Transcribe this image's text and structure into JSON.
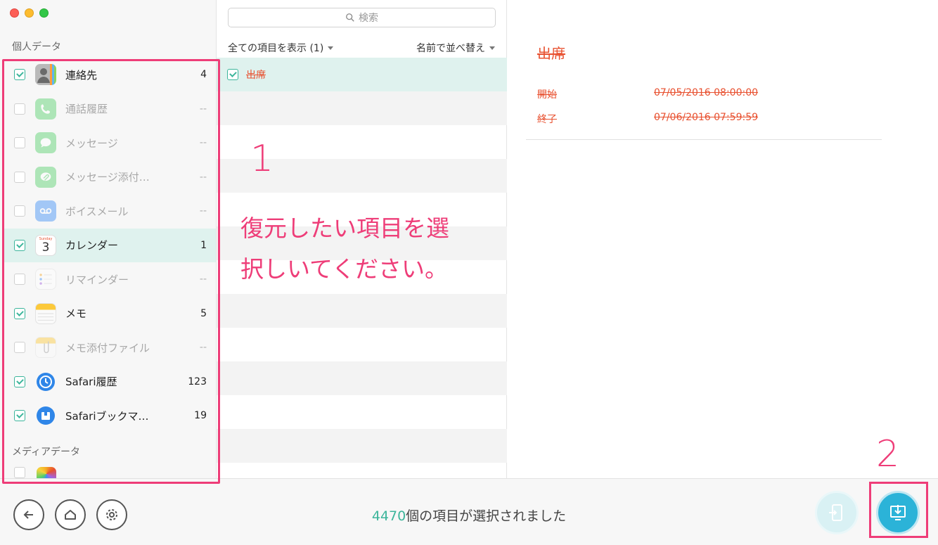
{
  "window": {
    "controls": [
      "close",
      "minimize",
      "zoom"
    ]
  },
  "sidebar": {
    "section_personal": "個人データ",
    "section_media": "メディアデータ",
    "items": [
      {
        "label": "連絡先",
        "count": "4",
        "checked": true,
        "enabled": true,
        "icon": "contacts-icon"
      },
      {
        "label": "通話履歴",
        "count": "--",
        "checked": false,
        "enabled": false,
        "icon": "phone-icon"
      },
      {
        "label": "メッセージ",
        "count": "--",
        "checked": false,
        "enabled": false,
        "icon": "messages-icon"
      },
      {
        "label": "メッセージ添付…",
        "count": "--",
        "checked": false,
        "enabled": false,
        "icon": "message-attachment-icon"
      },
      {
        "label": "ボイスメール",
        "count": "--",
        "checked": false,
        "enabled": false,
        "icon": "voicemail-icon"
      },
      {
        "label": "カレンダー",
        "count": "1",
        "checked": true,
        "enabled": true,
        "selected": true,
        "icon": "calendar-icon"
      },
      {
        "label": "リマインダー",
        "count": "--",
        "checked": false,
        "enabled": false,
        "icon": "reminders-icon"
      },
      {
        "label": "メモ",
        "count": "5",
        "checked": true,
        "enabled": true,
        "icon": "notes-icon"
      },
      {
        "label": "メモ添付ファイル",
        "count": "--",
        "checked": false,
        "enabled": false,
        "icon": "notes-attachment-icon"
      },
      {
        "label": "Safari履歴",
        "count": "123",
        "checked": true,
        "enabled": true,
        "icon": "safari-history-icon"
      },
      {
        "label": "Safariブックマ…",
        "count": "19",
        "checked": true,
        "enabled": true,
        "icon": "safari-bookmark-icon"
      }
    ],
    "calendar_icon_day": "3",
    "calendar_icon_weekday": "Sunday"
  },
  "middle": {
    "search_placeholder": "検索",
    "show_all": "全ての項目を表示 (1)",
    "sort": "名前で並べ替え",
    "rows": [
      {
        "label": "出席",
        "checked": true
      }
    ]
  },
  "annotations": {
    "step1": "1",
    "step1_text": "復元したい項目を選択しいてください。",
    "step2": "2"
  },
  "detail": {
    "title": "出席",
    "start_label": "開始",
    "start_value": "07/05/2016 08:00:00",
    "end_label": "終了",
    "end_value": "07/06/2016 07:59:59"
  },
  "footer": {
    "count": "4470",
    "status_suffix": "個の項目が選択されました"
  },
  "colors": {
    "accent": "#3cb59b",
    "highlight": "#ee3d78",
    "deleted_text": "#e8502f",
    "recover_button": "#2bb3d8"
  }
}
